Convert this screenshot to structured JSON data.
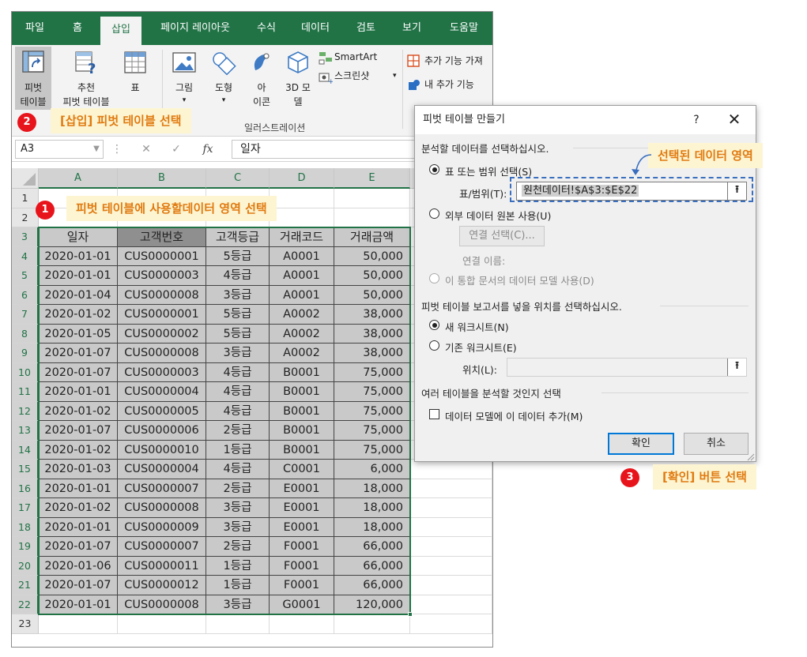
{
  "menu": {
    "tabs": [
      "파일",
      "홈",
      "삽입",
      "페이지 레이아웃",
      "수식",
      "데이터",
      "검토",
      "보기",
      "도움말"
    ],
    "active_tab": "삽입"
  },
  "ribbon": {
    "pivot": {
      "line1": "피벗",
      "line2": "테이블"
    },
    "recommended_pivot": {
      "line1": "추천",
      "line2": "피벗 테이블"
    },
    "table": "표",
    "picture": "그림",
    "shapes": "도형",
    "icons": {
      "line1": "아",
      "line2": "이콘"
    },
    "model3d": {
      "line1": "3D 모",
      "line2": "델"
    },
    "smartart": "SmartArt",
    "screenshot": "스크린샷",
    "illustrations_group": "일러스트레이션",
    "get_addins": "추가 기능 가져",
    "my_addins": "내 추가 기능"
  },
  "formula_bar": {
    "name_box": "A3",
    "fx": "fx",
    "value": "일자"
  },
  "grid": {
    "columns": [
      "A",
      "B",
      "C",
      "D",
      "E"
    ],
    "row_numbers": [
      "1",
      "2",
      "3",
      "4",
      "5",
      "6",
      "7",
      "8",
      "9",
      "10",
      "11",
      "12",
      "13",
      "14",
      "15",
      "16",
      "17",
      "18",
      "19",
      "20",
      "21",
      "22",
      "23"
    ],
    "headers": [
      "일자",
      "고객번호",
      "고객등급",
      "거래코드",
      "거래금액"
    ],
    "rows": [
      [
        "2020-01-01",
        "CUS0000001",
        "5등급",
        "A0001",
        "50,000"
      ],
      [
        "2020-01-01",
        "CUS0000003",
        "4등급",
        "A0001",
        "50,000"
      ],
      [
        "2020-01-04",
        "CUS0000008",
        "3등급",
        "A0001",
        "50,000"
      ],
      [
        "2020-01-02",
        "CUS0000001",
        "5등급",
        "A0002",
        "38,000"
      ],
      [
        "2020-01-05",
        "CUS0000002",
        "5등급",
        "A0002",
        "38,000"
      ],
      [
        "2020-01-07",
        "CUS0000008",
        "3등급",
        "A0002",
        "38,000"
      ],
      [
        "2020-01-07",
        "CUS0000003",
        "4등급",
        "B0001",
        "75,000"
      ],
      [
        "2020-01-01",
        "CUS0000004",
        "4등급",
        "B0001",
        "75,000"
      ],
      [
        "2020-01-02",
        "CUS0000005",
        "4등급",
        "B0001",
        "75,000"
      ],
      [
        "2020-01-07",
        "CUS0000006",
        "2등급",
        "B0001",
        "75,000"
      ],
      [
        "2020-01-02",
        "CUS0000010",
        "1등급",
        "B0001",
        "75,000"
      ],
      [
        "2020-01-03",
        "CUS0000004",
        "4등급",
        "C0001",
        "6,000"
      ],
      [
        "2020-01-01",
        "CUS0000007",
        "2등급",
        "E0001",
        "18,000"
      ],
      [
        "2020-01-02",
        "CUS0000008",
        "3등급",
        "E0001",
        "18,000"
      ],
      [
        "2020-01-01",
        "CUS0000009",
        "3등급",
        "E0001",
        "18,000"
      ],
      [
        "2020-01-07",
        "CUS0000007",
        "2등급",
        "F0001",
        "66,000"
      ],
      [
        "2020-01-06",
        "CUS0000011",
        "1등급",
        "F0001",
        "66,000"
      ],
      [
        "2020-01-07",
        "CUS0000012",
        "1등급",
        "F0001",
        "66,000"
      ],
      [
        "2020-01-01",
        "CUS0000008",
        "3등급",
        "G0001",
        "120,000"
      ]
    ]
  },
  "dialog": {
    "title": "피벗 테이블 만들기",
    "help": "?",
    "close": "✕",
    "section1": "분석할 데이터를 선택하십시오.",
    "option_table_range": "표 또는 범위 선택(S)",
    "range_label": "표/범위(T):",
    "range_value": "원천데이터!$A$3:$E$22",
    "option_external": "외부 데이터 원본 사용(U)",
    "choose_connection": "연결 선택(C)...",
    "connection_name": "연결 이름:",
    "option_data_model": "이 통합 문서의 데이터 모델 사용(D)",
    "section2": "피벗 테이블 보고서를 넣을 위치를 선택하십시오.",
    "option_new_sheet": "새 워크시트(N)",
    "option_existing_sheet": "기존 워크시트(E)",
    "location_label": "위치(L):",
    "section3": "여러 테이블을 분석할 것인지 선택",
    "add_to_model": "데이터 모델에 이 데이터 추가(M)",
    "ok": "확인",
    "cancel": "취소",
    "collapse_icon": "⭱"
  },
  "annotations": {
    "step1_num": "1",
    "step1_text": "피벗 테이블에 사용할데이터 영역 선택",
    "step2_num": "2",
    "step2_text": "[삽입] 피벗 테이블 선택",
    "step3_num": "3",
    "step3_text": "[확인] 버튼 선택",
    "selected_area": "선택된 데이터 영역"
  }
}
